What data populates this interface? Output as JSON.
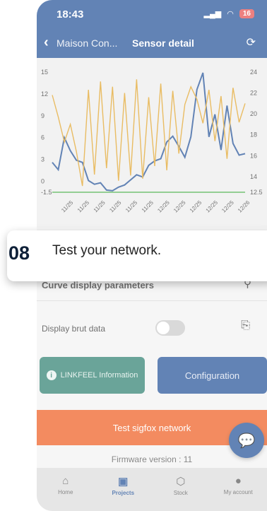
{
  "status_bar": {
    "time": "18:43",
    "battery": "16"
  },
  "nav": {
    "back_label": "Maison Con...",
    "title": "Sensor detail"
  },
  "chart_data": {
    "type": "line",
    "categories": [
      "11/25",
      "11/25",
      "11/25",
      "11/25",
      "11/25",
      "11/25",
      "12/25",
      "12/25",
      "12/25",
      "12/25",
      "12/25",
      "12/26"
    ],
    "y_left_ticks": [
      "15",
      "12",
      "9",
      "6",
      "3",
      "0",
      "-1.5"
    ],
    "y_right_ticks": [
      "24",
      "22",
      "20",
      "18",
      "16",
      "14",
      "12.5"
    ],
    "ylim_left": [
      -1.5,
      15
    ],
    "ylim_right": [
      12.5,
      24
    ],
    "series": [
      {
        "color": "#1f4e96",
        "axis": "left",
        "values": [
          2.6,
          1.6,
          6,
          4.2,
          2.9,
          2.6,
          0.1,
          -0.4,
          -0.2,
          -1.2,
          -1.3,
          -0.8,
          -0.5,
          0.2,
          0.9,
          0.6,
          2.2,
          2.8,
          3.1,
          5.4,
          6.2,
          4.8,
          3.3,
          6.1,
          12.6,
          14.9,
          6.1,
          9.2,
          4.3,
          10.4,
          5.2,
          3.6,
          3.8
        ]
      },
      {
        "color": "#e0a020",
        "axis": "right",
        "values": [
          21.8,
          19.7,
          17.3,
          19,
          16.4,
          13.1,
          22.3,
          14.2,
          23.1,
          14.8,
          22.6,
          13.6,
          22,
          14.1,
          23.3,
          13.8,
          21.6,
          15,
          22.9,
          14.6,
          22.2,
          16.2,
          20.9,
          22.6,
          21.4,
          19.1,
          22.3,
          17.4,
          21.7,
          15.7,
          22.5,
          19.2,
          21
        ]
      },
      {
        "color": "#3aa83a",
        "axis": "left",
        "values": [
          -1.5,
          -1.5,
          -1.5,
          -1.5,
          -1.5,
          -1.5,
          -1.5,
          -1.5,
          -1.5,
          -1.5,
          -1.5,
          -1.5,
          -1.5,
          -1.5,
          -1.5,
          -1.5,
          -1.5,
          -1.5,
          -1.5,
          -1.5,
          -1.5,
          -1.5,
          -1.5,
          -1.5,
          -1.5,
          -1.5,
          -1.5,
          -1.5,
          -1.5,
          -1.5,
          -1.5,
          -1.5,
          -1.5
        ]
      }
    ]
  },
  "callout": {
    "step": "08",
    "text": "Test your network."
  },
  "panel": {
    "title": "Curve display parameters",
    "brut_label": "Display brut data"
  },
  "buttons": {
    "linkfeel": "LINKFEEL Information",
    "config": "Configuration",
    "sigfox": "Test sigfox network"
  },
  "firmware": "Firmware version : 11",
  "tabs": [
    {
      "label": "Home",
      "icon": "home-icon"
    },
    {
      "label": "Projects",
      "icon": "briefcase-icon"
    },
    {
      "label": "Stock",
      "icon": "box-icon"
    },
    {
      "label": "My account",
      "icon": "user-icon"
    }
  ],
  "colors": {
    "primary": "#1f4e96",
    "accent": "#ee5a1c",
    "teal": "#2a7d6d"
  }
}
